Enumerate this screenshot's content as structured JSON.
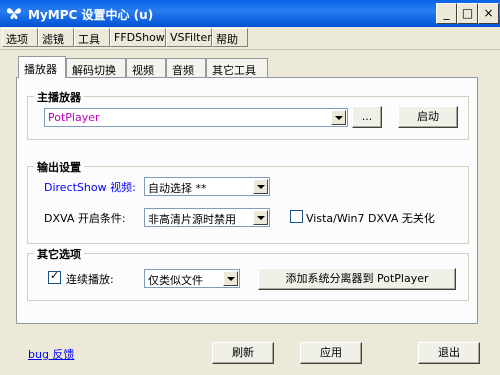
{
  "window": {
    "title": "MyMPC 设置中心 (u)",
    "controls": {
      "minimize": "_",
      "maximize": "□",
      "close": "×"
    }
  },
  "menu": [
    "选项",
    "滤镜",
    "工具",
    "FFDShow",
    "VSFilter",
    "帮助"
  ],
  "tabs": [
    "播放器",
    "解码切换",
    "视频",
    "音频",
    "其它工具"
  ],
  "main_player": {
    "title": "主播放器",
    "value": "PotPlayer",
    "browse_label": "...",
    "start_label": "启动"
  },
  "output": {
    "title": "输出设置",
    "directshow_label": "DirectShow 视频:",
    "directshow_value": "自动选择 **",
    "dxva_label": "DXVA 开启条件:",
    "dxva_value": "非高清片源时禁用",
    "vista_label": "Vista/Win7 DXVA 无关化",
    "vista_checked": false
  },
  "other": {
    "title": "其它选项",
    "continuous_label": "连续播放:",
    "continuous_checked": true,
    "continuous_value": "仅类似文件",
    "add_splitter_label": "添加系统分离器到 PotPlayer"
  },
  "footer": {
    "bug_link": "bug 反馈",
    "refresh": "刷新",
    "apply": "应用",
    "exit": "退出"
  },
  "colors": {
    "title_bar": "#0a64e8",
    "player_value": "#c000c0",
    "directshow_label": "#0000ff",
    "link": "#0000ff"
  }
}
